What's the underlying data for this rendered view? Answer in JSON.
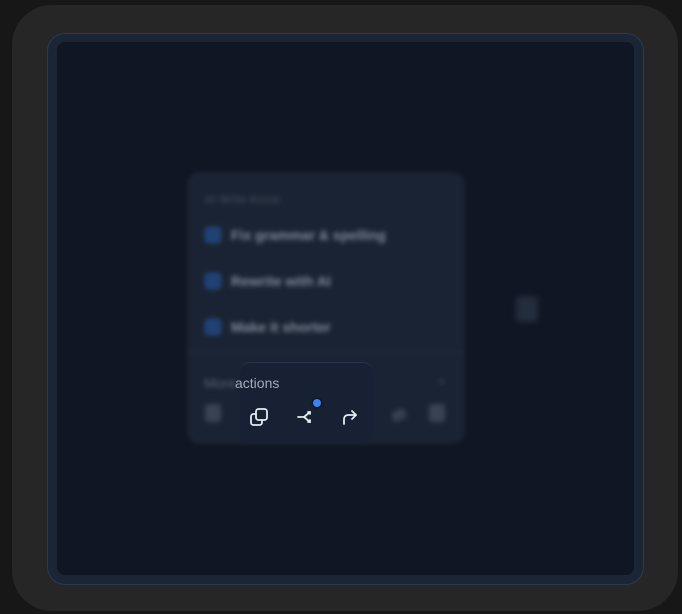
{
  "popover": {
    "section_heading": "AI Write Assist",
    "options": [
      {
        "label": "Fix grammar & spelling",
        "checked": true
      },
      {
        "label": "Rewrite with AI",
        "checked": true
      },
      {
        "label": "Make it shorter",
        "checked": true
      }
    ],
    "more_prefix": "More",
    "more_label": "actions"
  },
  "toolbar": {
    "icons": [
      "trash-icon",
      "copy-icon",
      "share-branch-icon",
      "forward-arrow-icon",
      "pen-icon",
      "trash-icon"
    ],
    "notification_color": "#3b82f6"
  },
  "colors": {
    "background": "#0f1624",
    "card": "#1c2535",
    "accent": "#3b82f6"
  }
}
